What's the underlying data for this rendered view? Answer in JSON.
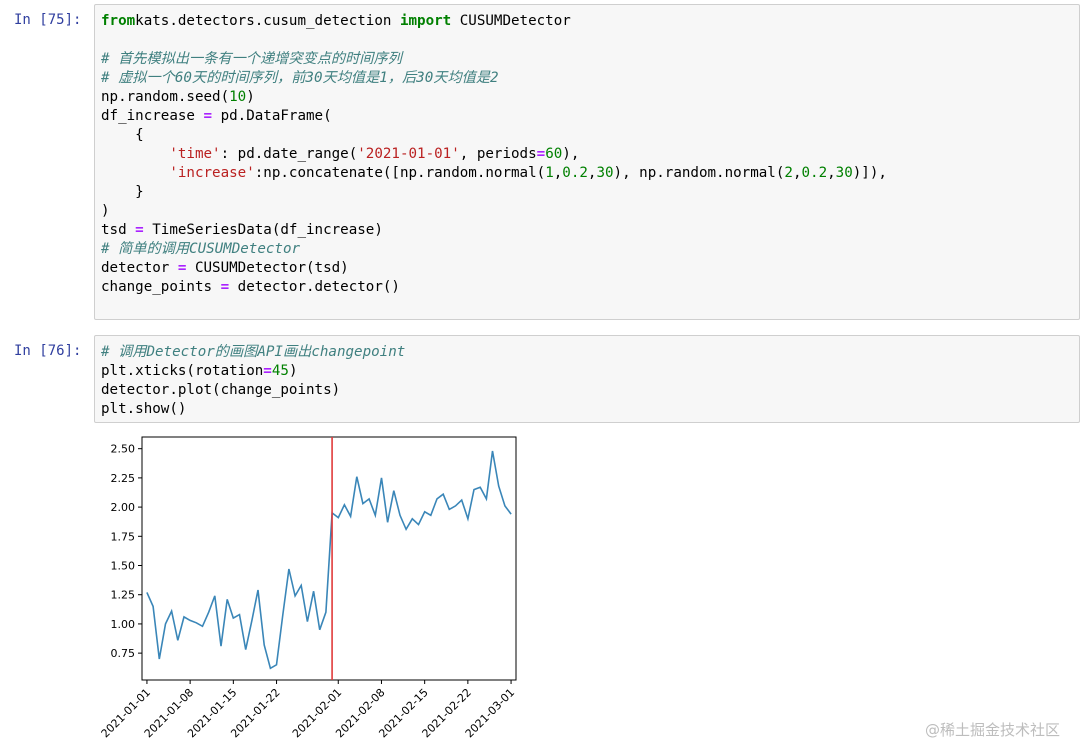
{
  "cell75": {
    "prompt": "In [75]:",
    "lines": [
      [
        [
          "kw",
          "from"
        ],
        [
          "",
          "kats.detectors.cusum_detection "
        ],
        [
          "kw",
          "import"
        ],
        [
          "",
          " CUSUMDetector"
        ]
      ],
      [],
      [
        [
          "cm",
          "# 首先模拟出一条有一个递增突变点的时间序列"
        ]
      ],
      [
        [
          "cm",
          "# 虚拟一个60天的时间序列，前30天均值是1，后30天均值是2"
        ]
      ],
      [
        [
          "",
          "np.random.seed("
        ],
        [
          "nu",
          "10"
        ],
        [
          "",
          ")"
        ]
      ],
      [
        [
          "",
          "df_increase "
        ],
        [
          "op",
          "="
        ],
        [
          "",
          " pd.DataFrame("
        ]
      ],
      [
        [
          "",
          "    {"
        ]
      ],
      [
        [
          "",
          "        "
        ],
        [
          "st",
          "'time'"
        ],
        [
          "",
          ": pd.date_range("
        ],
        [
          "st",
          "'2021-01-01'"
        ],
        [
          "",
          ", periods"
        ],
        [
          "op",
          "="
        ],
        [
          "nu",
          "60"
        ],
        [
          "",
          "),"
        ]
      ],
      [
        [
          "",
          "        "
        ],
        [
          "st",
          "'increase'"
        ],
        [
          "",
          ":np.concatenate([np.random.normal("
        ],
        [
          "nu",
          "1"
        ],
        [
          "",
          ","
        ],
        [
          "nu",
          "0.2"
        ],
        [
          "",
          ","
        ],
        [
          "nu",
          "30"
        ],
        [
          "",
          "), np.random.normal("
        ],
        [
          "nu",
          "2"
        ],
        [
          "",
          ","
        ],
        [
          "nu",
          "0.2"
        ],
        [
          "",
          ","
        ],
        [
          "nu",
          "30"
        ],
        [
          "",
          ")]),"
        ]
      ],
      [
        [
          "",
          "    }"
        ]
      ],
      [
        [
          "",
          ")"
        ]
      ],
      [
        [
          "",
          "tsd "
        ],
        [
          "op",
          "="
        ],
        [
          "",
          " TimeSeriesData(df_increase)"
        ]
      ],
      [
        [
          "cm",
          "# 简单的调用CUSUMDetector"
        ]
      ],
      [
        [
          "",
          "detector "
        ],
        [
          "op",
          "="
        ],
        [
          "",
          " CUSUMDetector(tsd)"
        ]
      ],
      [
        [
          "",
          "change_points "
        ],
        [
          "op",
          "="
        ],
        [
          "",
          " detector.detector()"
        ]
      ]
    ]
  },
  "cell76": {
    "prompt": "In [76]:",
    "lines": [
      [
        [
          "cm",
          "# 调用Detector的画图API画出changepoint"
        ]
      ],
      [
        [
          "",
          "plt.xticks(rotation"
        ],
        [
          "op",
          "="
        ],
        [
          "nu",
          "45"
        ],
        [
          "",
          ")"
        ]
      ],
      [
        [
          "",
          "detector.plot(change_points)"
        ]
      ],
      [
        [
          "",
          "plt.show()"
        ]
      ]
    ]
  },
  "chart_data": {
    "type": "line",
    "x_start": "2021-01-01",
    "values": [
      1.27,
      1.15,
      0.7,
      1.0,
      1.11,
      0.86,
      1.06,
      1.03,
      1.01,
      0.98,
      1.1,
      1.24,
      0.81,
      1.21,
      1.05,
      1.08,
      0.78,
      1.03,
      1.29,
      0.82,
      0.62,
      0.65,
      1.07,
      1.47,
      1.24,
      1.33,
      1.02,
      1.28,
      0.95,
      1.1,
      1.95,
      1.91,
      2.02,
      1.92,
      2.26,
      2.03,
      2.07,
      1.93,
      2.25,
      1.87,
      2.14,
      1.93,
      1.81,
      1.9,
      1.85,
      1.96,
      1.93,
      2.07,
      2.11,
      1.98,
      2.01,
      2.06,
      1.9,
      2.15,
      2.17,
      2.07,
      2.48,
      2.18,
      2.01,
      1.94
    ],
    "change_point": "2021-01-31",
    "line_color": "#3a86b8",
    "change_point_color": "#e03b3b",
    "ylim": [
      0.52,
      2.6
    ],
    "yticks": [
      "0.75",
      "1.00",
      "1.25",
      "1.50",
      "1.75",
      "2.00",
      "2.25",
      "2.50"
    ],
    "xticks": [
      "2021-01-01",
      "2021-01-08",
      "2021-01-15",
      "2021-01-22",
      "2021-02-01",
      "2021-02-08",
      "2021-02-15",
      "2021-02-22",
      "2021-03-01"
    ],
    "title": "",
    "xlabel": "",
    "ylabel": ""
  },
  "watermark": "@稀土掘金技术社区"
}
